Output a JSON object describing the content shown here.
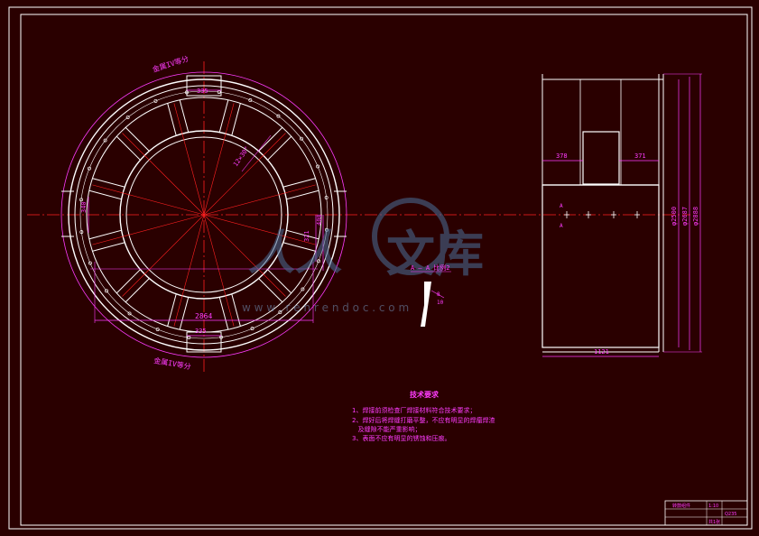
{
  "colors": {
    "background": "#2a0000",
    "frame": "#ffffff",
    "centerline": "#ff2020",
    "dimension": "#ff3cff",
    "geometry": "#ffffff",
    "watermark": "#4a6f9a"
  },
  "drawing": {
    "plan_view": {
      "labels": {
        "weld_top": "金属IV等分",
        "weld_bottom": "金属IV等分",
        "dim_top": "335",
        "dim_bottom": "335",
        "dim_width": "2864",
        "dim_left": "340",
        "dim_right_upper": "400",
        "dim_right_lower": "321",
        "angle": "12×30°"
      }
    },
    "side_view": {
      "labels": {
        "dim_left_top": "378",
        "dim_right_top": "371",
        "dim_bottom": "1121",
        "dia_1": "φ2500",
        "dia_2": "φ2687",
        "dia_3": "φ2888",
        "section_mark_top": "A",
        "section_mark_bottom": "A"
      }
    },
    "detail": {
      "title": "A — A 比例2",
      "dim_a": "8",
      "dim_b": "10"
    },
    "tech_requirements": {
      "title": "技术要求",
      "lines": [
        "1、焊接前须检查厂焊接材料符合技术要求；",
        "2、焊好后将焊缝打磨平整，不应有明显的焊瘤焊渣",
        "   及缝隙不能严重影响；",
        "3、表面不应有明显的锈蚀和压痕。"
      ]
    },
    "title_block": {
      "name": "转鼓组件",
      "scale": "1:10",
      "material": "Q235",
      "sheet": "共1张"
    },
    "watermark": {
      "brand": "文库",
      "url": "w w w . r e n r e n d o c . c o m"
    }
  }
}
